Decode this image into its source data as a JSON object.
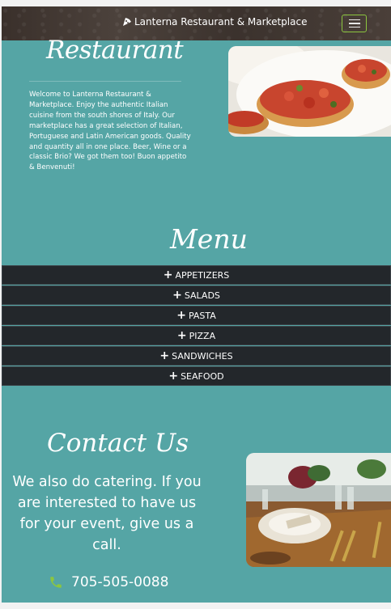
{
  "header": {
    "brand_name": "Lanterna Restaurant & Marketplace",
    "brand_icon": "pizza-slice-icon",
    "menu_icon": "hamburger-menu-icon",
    "accent_color": "#8cc63f"
  },
  "about": {
    "title": "Restaurant",
    "text": "Welcome to Lanterna Restaurant & Marketplace. Enjoy the authentic Italian cuisine from the south shores of Italy. Our marketplace has a great selection of Italian, Portuguese and Latin American goods. Quality and quantity all in one place. Beer, Wine or a classic Brio? We got them too! Buon appetito & Benvenuti!"
  },
  "menu": {
    "title": "Menu",
    "items": [
      "APPETIZERS",
      "SALADS",
      "PASTA",
      "PIZZA",
      "SANDWICHES",
      "SEAFOOD"
    ]
  },
  "contact": {
    "title": "Contact Us",
    "text": "We also do catering. If you are interested to have us for your event, give us a call.",
    "phone": "705-505-0088",
    "phone_icon": "phone-icon"
  },
  "colors": {
    "background": "#55a5a5",
    "menu_row": "#23272b"
  }
}
